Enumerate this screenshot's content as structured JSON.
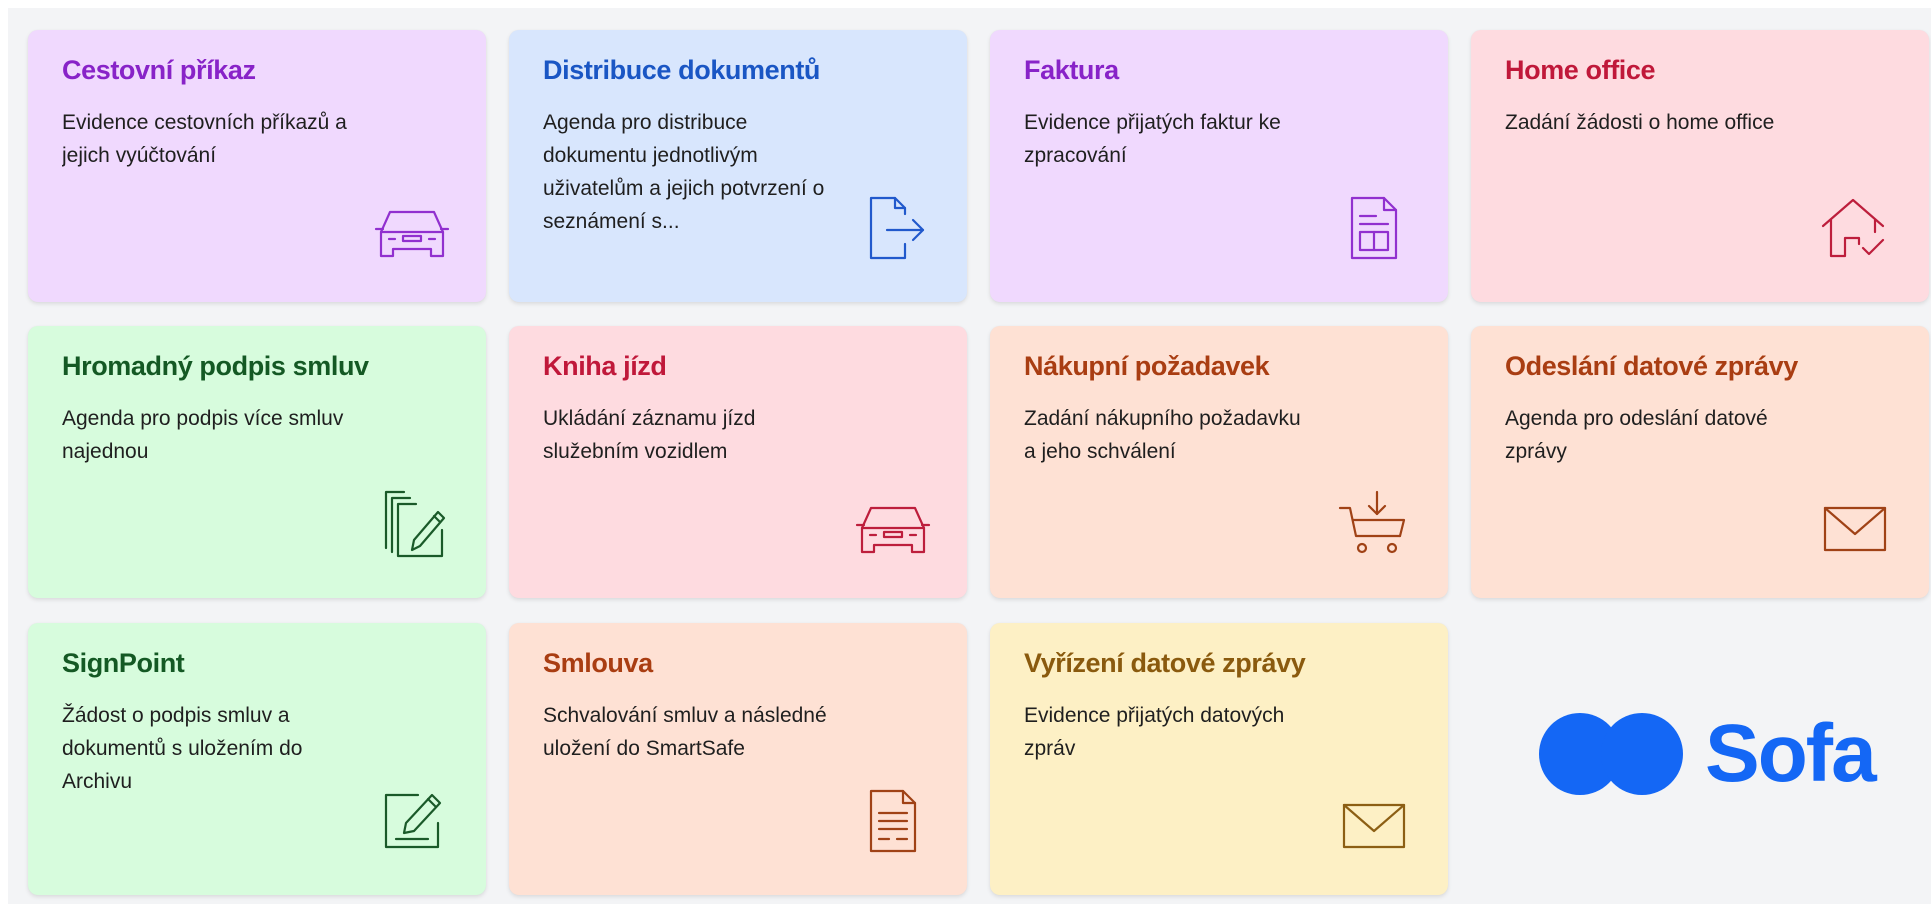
{
  "cards": [
    {
      "title": "Cestovní příkaz",
      "description": "Evidence cestovních příkazů a jejich vyúčtování",
      "icon": "car-icon",
      "color": "#8823c8"
    },
    {
      "title": "Distribuce dokumentů",
      "description": "Agenda pro distribuce dokumentu jednotlivým uživatelům a jejich potvrzení o seznámení s...",
      "icon": "document-send-icon",
      "color": "#1a56c4"
    },
    {
      "title": "Faktura",
      "description": "Evidence přijatých faktur ke zpracování",
      "icon": "invoice-icon",
      "color": "#8823c8"
    },
    {
      "title": "Home office",
      "description": "Zadání žádosti o home office",
      "icon": "home-check-icon",
      "color": "#c0183a"
    },
    {
      "title": "Hromadný podpis smluv",
      "description": "Agenda pro podpis více smluv najednou",
      "icon": "multi-sign-icon",
      "color": "#145924"
    },
    {
      "title": "Kniha jízd",
      "description": "Ukládání záznamu jízd služebním vozidlem",
      "icon": "car-icon",
      "color": "#c0183a"
    },
    {
      "title": "Nákupní požadavek",
      "description": "Zadání nákupního požadavku a jeho schválení",
      "icon": "cart-icon",
      "color": "#a93d12"
    },
    {
      "title": "Odeslání datové zprávy",
      "description": "Agenda pro odeslání datové zprávy",
      "icon": "envelope-icon",
      "color": "#a93d12"
    },
    {
      "title": "SignPoint",
      "description": "Žádost o podpis smluv a dokumentů s uložením do Archivu",
      "icon": "sign-icon",
      "color": "#145924"
    },
    {
      "title": "Smlouva",
      "description": "Schvalování smluv a následné uložení do SmartSafe",
      "icon": "contract-document-icon",
      "color": "#a93d12"
    },
    {
      "title": "Vyřízení datové zprávy",
      "description": "Evidence přijatých datových zpráv",
      "icon": "envelope-icon",
      "color": "#8a5a0e"
    }
  ],
  "brand": {
    "name": "Sofa",
    "color": "#1467f5"
  }
}
